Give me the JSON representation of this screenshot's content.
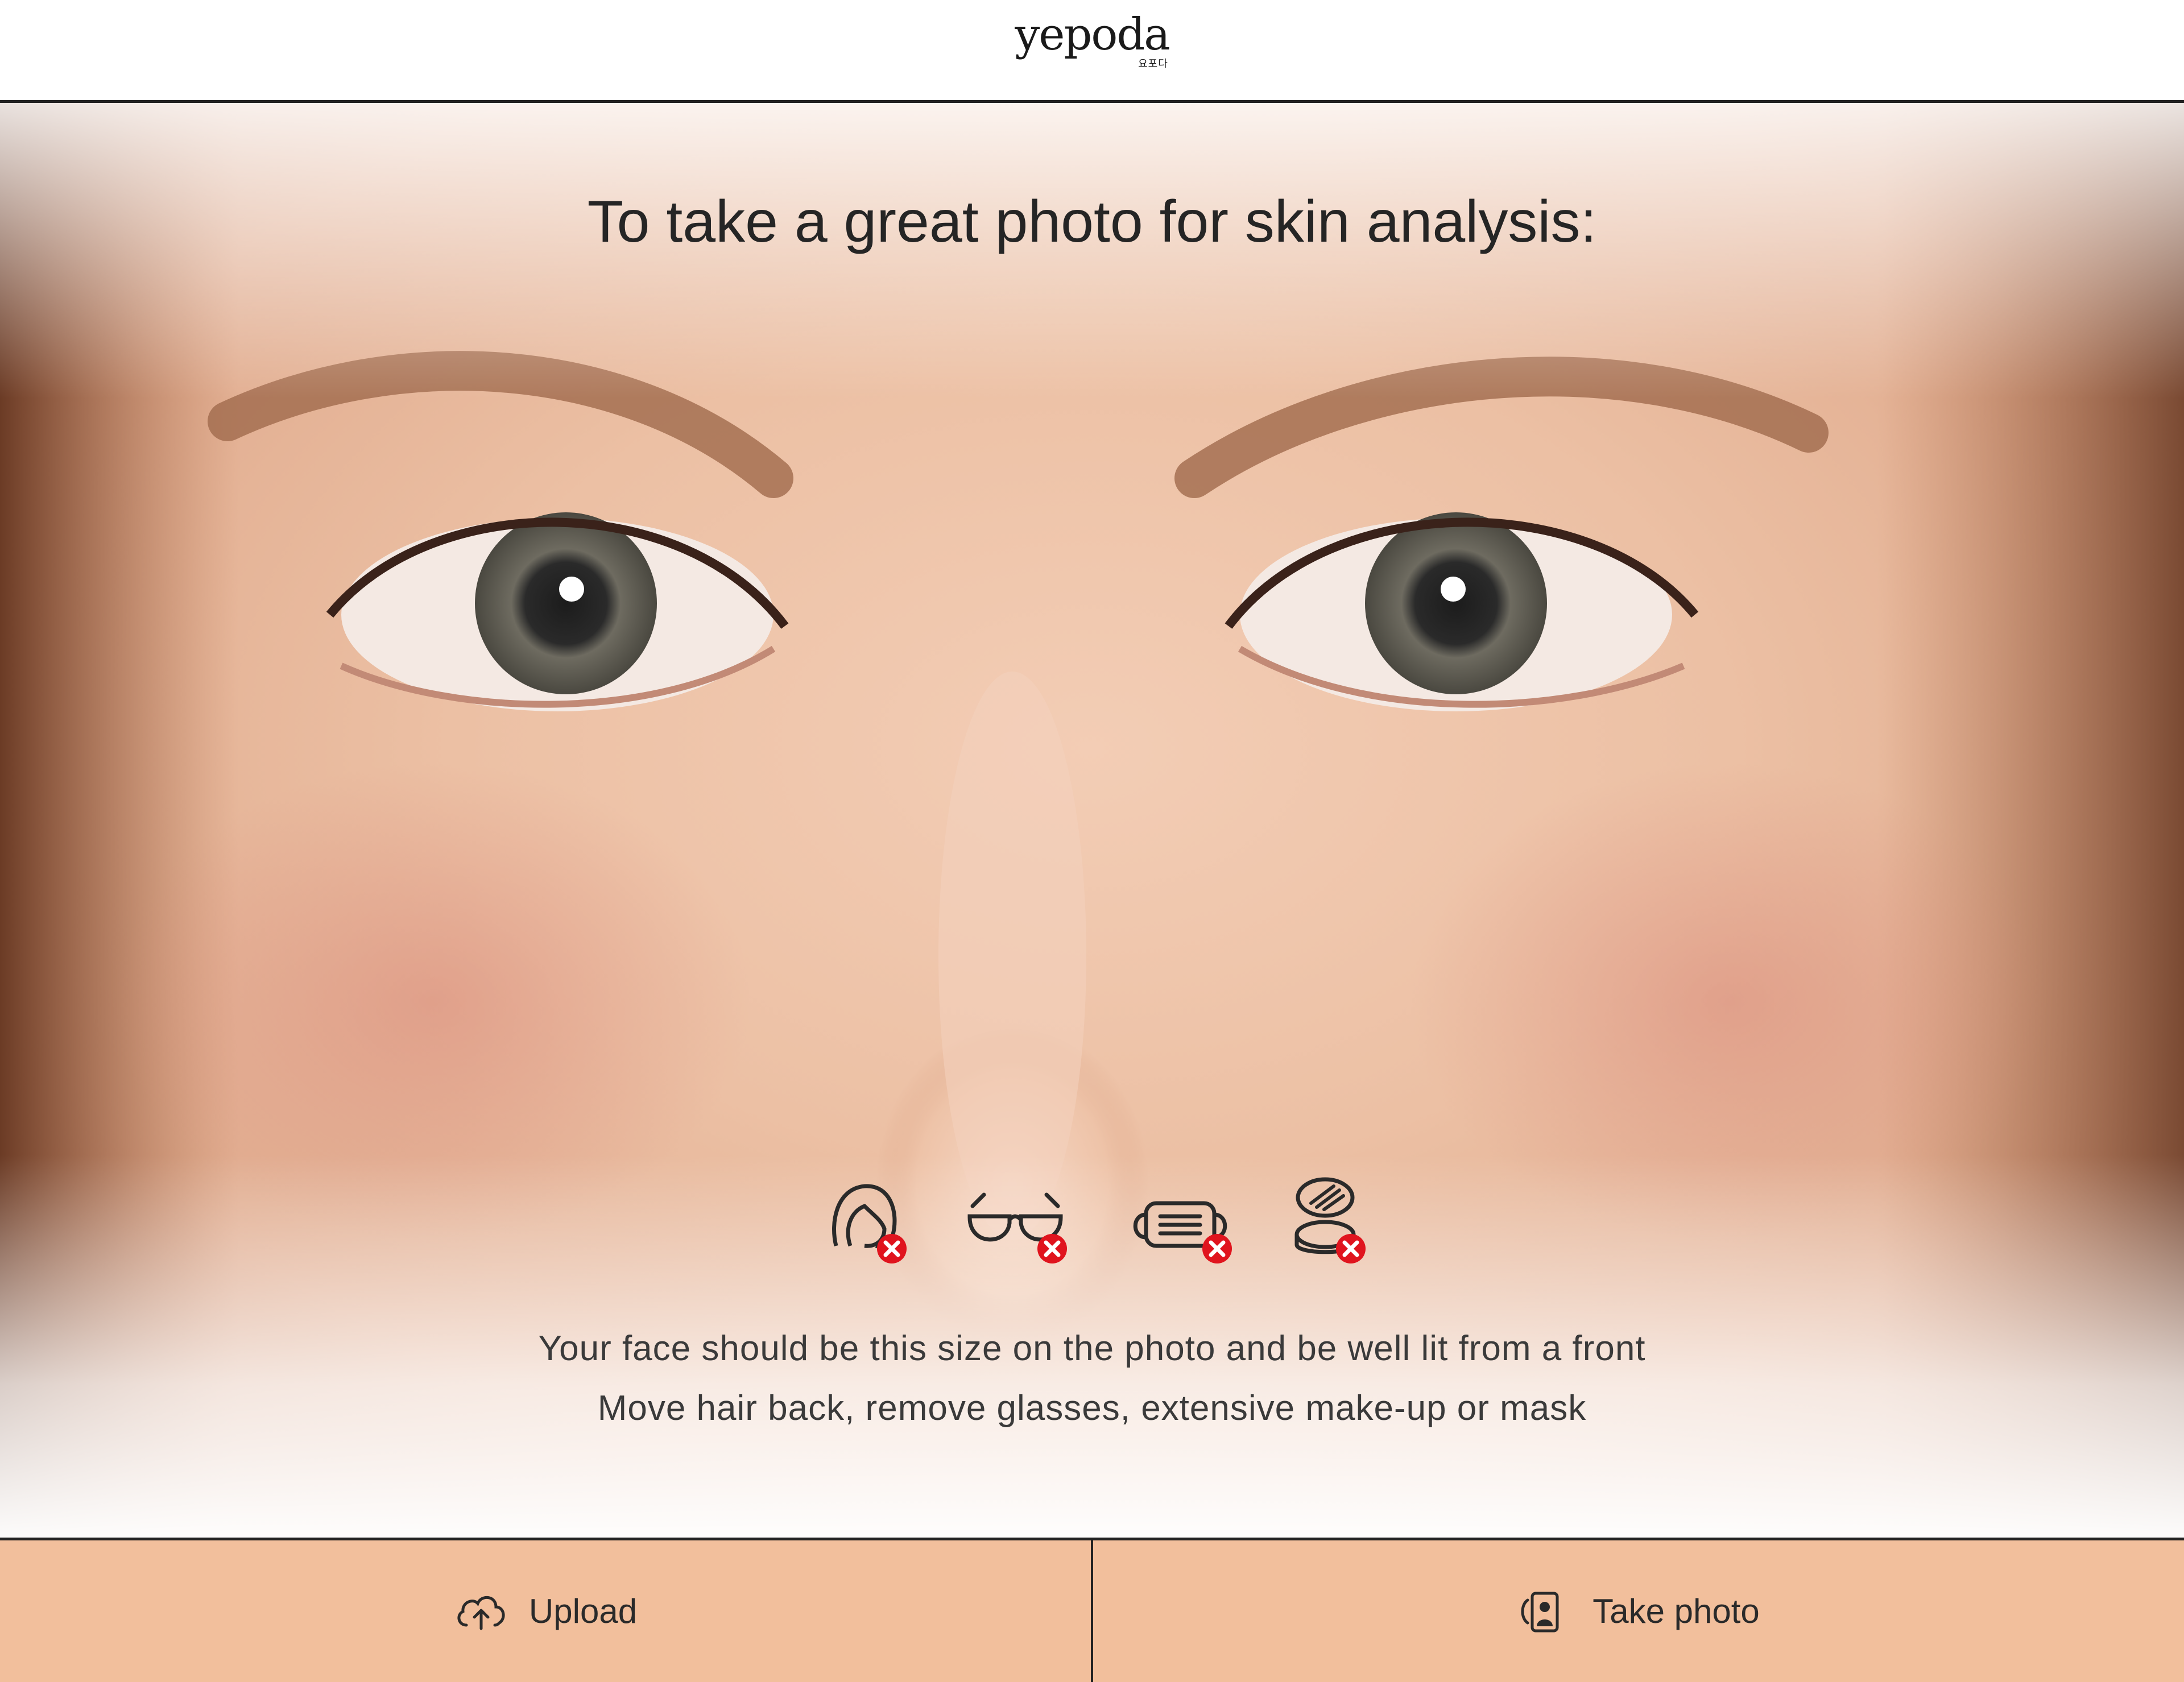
{
  "header": {
    "logo_text": "yepoda",
    "logo_subtext": "요포다"
  },
  "hero": {
    "headline": "To take a great photo for skin analysis:",
    "rules": [
      {
        "icon": "hair-face-icon",
        "status": "not-allowed"
      },
      {
        "icon": "glasses-icon",
        "status": "not-allowed"
      },
      {
        "icon": "mask-icon",
        "status": "not-allowed"
      },
      {
        "icon": "makeup-compact-icon",
        "status": "not-allowed"
      }
    ],
    "instruction_line1": "Your face should be this size on the photo and be well lit from a front",
    "instruction_line2": "Move hair back, remove glasses, extensive make-up or mask"
  },
  "actions": {
    "upload_label": "Upload",
    "take_photo_label": "Take photo"
  },
  "colors": {
    "button_bg": "#f2bf9c",
    "prohibited_badge": "#e0141e",
    "text": "#252525"
  }
}
